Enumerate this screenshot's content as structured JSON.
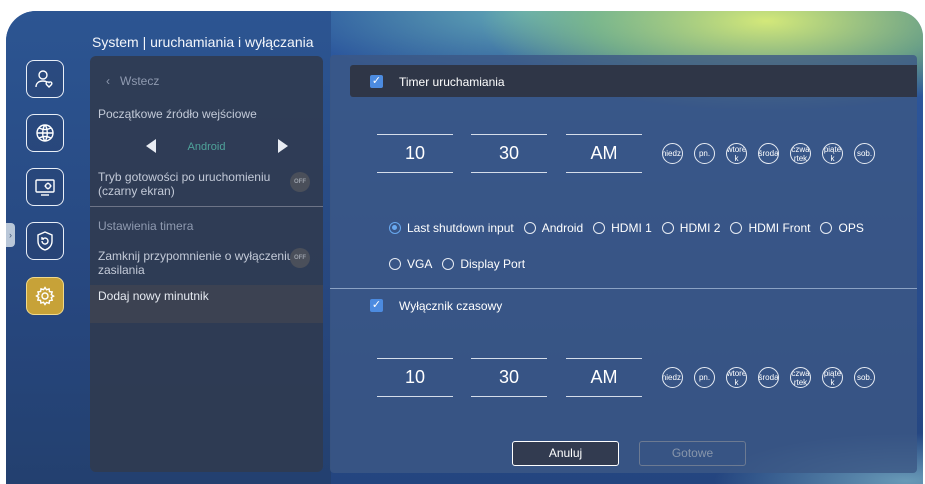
{
  "page_title": "System | uruchamiania i wyłączania",
  "side_nav": {
    "icons": [
      "user-heart-icon",
      "globe-icon",
      "display-settings-icon",
      "shield-restore-icon",
      "gear-icon"
    ]
  },
  "menu": {
    "back_label": "Wstecz",
    "input_source_label": "Początkowe źródło wejściowe",
    "input_source_value": "Android",
    "standby_label": "Tryb gotowości po uruchomieniu (czarny ekran)",
    "standby_toggle": "OFF",
    "timer_settings_label": "Ustawienia timera",
    "shutdown_reminder_label": "Zamknij przypomnienie o wyłączeniu zasilania",
    "shutdown_reminder_toggle": "OFF",
    "add_timer_label": "Dodaj nowy minutnik"
  },
  "power_on_timer": {
    "label": "Timer uruchamiania",
    "checked": true,
    "hour": "10",
    "minute": "30",
    "ampm": "AM",
    "days": [
      "niedz.",
      "pn.",
      "wtore k",
      "środa",
      "czwa rtek",
      "piąte k",
      "sob."
    ]
  },
  "input_options": {
    "row1": [
      "Last shutdown input",
      "Android",
      "HDMI 1",
      "HDMI 2",
      "HDMI Front",
      "OPS"
    ],
    "row2": [
      "VGA",
      "Display Port"
    ],
    "selected": "Last shutdown input"
  },
  "power_off_timer": {
    "label": "Wyłącznik czasowy",
    "checked": true,
    "hour": "10",
    "minute": "30",
    "ampm": "AM",
    "days": [
      "niedz.",
      "pn.",
      "wtore k",
      "środa",
      "czwa rtek",
      "piąte k",
      "sob."
    ]
  },
  "buttons": {
    "cancel": "Anuluj",
    "done": "Gotowe"
  },
  "colors": {
    "accent": "#4c8be0",
    "active_nav": "#c7a238",
    "source_value": "#4fa39a"
  }
}
